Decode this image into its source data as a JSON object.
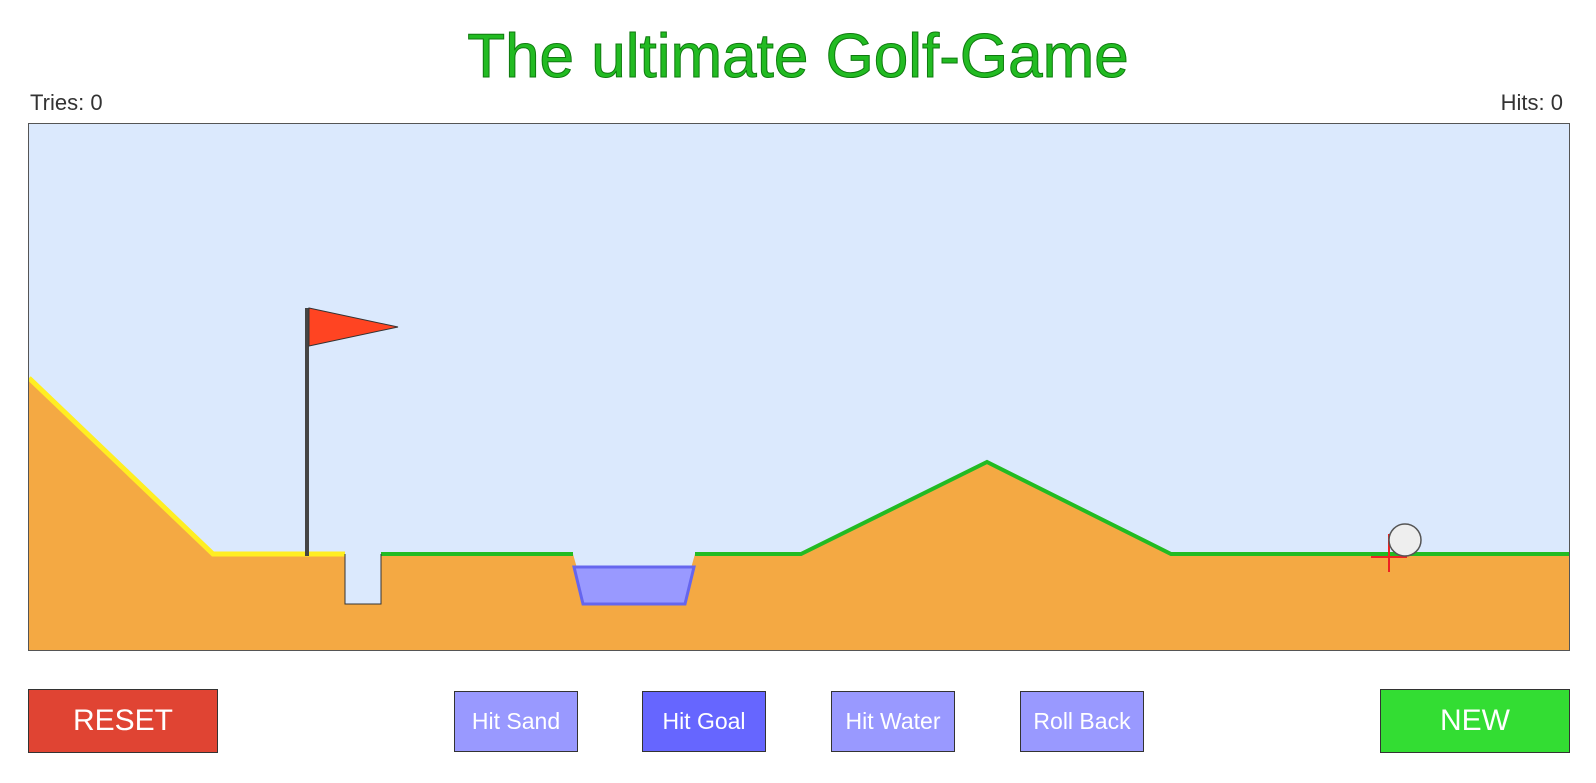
{
  "title": "The ultimate Golf-Game",
  "tries": {
    "label": "Tries:",
    "value": "0"
  },
  "hits": {
    "label": "Hits:",
    "value": "0"
  },
  "buttons": {
    "reset": {
      "label": "RESET",
      "color": "#e04433"
    },
    "hit_sand": {
      "label": "Hit Sand",
      "color": "#9999ff"
    },
    "hit_goal": {
      "label": "Hit Goal",
      "color": "#6666ff"
    },
    "hit_water": {
      "label": "Hit Water",
      "color": "#9999ff"
    },
    "roll_back": {
      "label": "Roll Back",
      "color": "#9999ff"
    },
    "new": {
      "label": "NEW",
      "color": "#33dd33"
    }
  },
  "colors": {
    "title": "#22bb22",
    "sky": "#dbe9fd",
    "ground": "#f4a943",
    "grass": "#22bb22",
    "sand": "#ffee22",
    "water": "#9999ff",
    "water_edge": "#6666ee",
    "flag": "#ff4422",
    "pole": "#444444",
    "ball": "#eeeeee",
    "aim_marker": "#ee2222"
  },
  "icons": {
    "flag": "flag-icon",
    "ball": "golf-ball-icon",
    "aim": "crosshair-icon"
  }
}
